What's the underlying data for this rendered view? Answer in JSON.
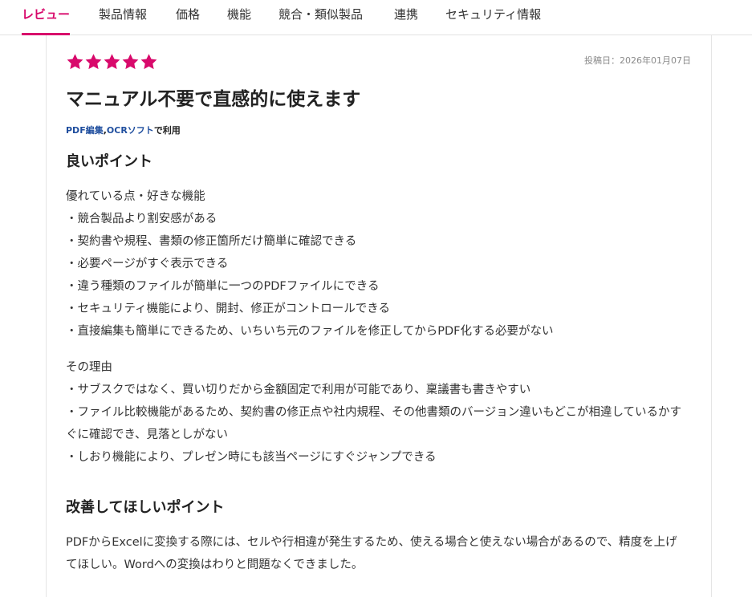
{
  "tabs": [
    {
      "label": "レビュー",
      "active": true
    },
    {
      "label": "製品情報",
      "active": false
    },
    {
      "label": "価格",
      "active": false
    },
    {
      "label": "機能",
      "active": false
    },
    {
      "label": "競合・類似製品",
      "active": false
    },
    {
      "label": "連携",
      "active": false
    },
    {
      "label": "セキュリティ情報",
      "active": false
    }
  ],
  "review": {
    "rating": 5,
    "rating_max": 5,
    "star_icon": "star-icon",
    "star_color": "#d8096b",
    "date": "投稿日：2026年01月07日",
    "title": "マニュアル不要で直感的に使えます",
    "usage": {
      "links": [
        "PDF編集",
        "OCRソフト"
      ],
      "separator": ",",
      "suffix": "で利用"
    },
    "good": {
      "heading": "良いポイント",
      "features_heading": "優れている点・好きな機能",
      "features": [
        "・競合製品より割安感がある",
        "・契約書や規程、書類の修正箇所だけ簡単に確認できる",
        "・必要ページがすぐ表示できる",
        "・違う種類のファイルが簡単に一つのPDFファイルにできる",
        "・セキュリティ機能により、開封、修正がコントロールできる",
        "・直接編集も簡単にできるため、いちいち元のファイルを修正してからPDF化する必要がない"
      ],
      "reasons_heading": "その理由",
      "reasons": [
        "・サブスクではなく、買い切りだから金額固定で利用が可能であり、稟議書も書きやすい",
        "・ファイル比較機能があるため、契約書の修正点や社内規程、その他書類のバージョン違いもどこが相違しているかすぐに確認でき、見落としがない",
        "・しおり機能により、プレゼン時にも該当ページにすぐジャンプできる"
      ]
    },
    "improve": {
      "heading": "改善してほしいポイント",
      "text": "PDFからExcelに変換する際には、セルや行相違が発生するため、使える場合と使えない場合があるので、精度を上げてほしい。Wordへの変換はわりと問題なくできました。"
    }
  }
}
